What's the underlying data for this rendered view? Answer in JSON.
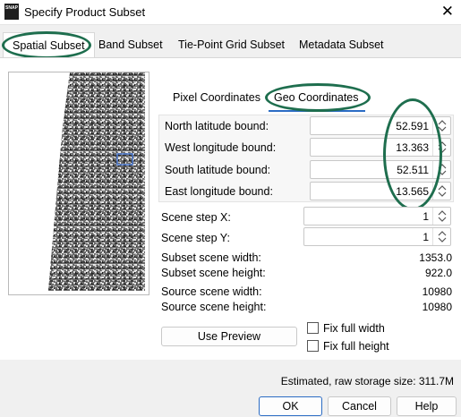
{
  "window": {
    "title": "Specify Product Subset",
    "app_icon_text": "SNAP"
  },
  "tabs": [
    {
      "label": "Spatial Subset",
      "active": true
    },
    {
      "label": "Band Subset"
    },
    {
      "label": "Tie-Point Grid Subset"
    },
    {
      "label": "Metadata Subset"
    }
  ],
  "sub_tabs": [
    {
      "label": "Pixel Coordinates"
    },
    {
      "label": "Geo Coordinates",
      "active": true
    }
  ],
  "geo": {
    "north_label": "North latitude bound:",
    "north_value": "52.591",
    "west_label": "West longitude bound:",
    "west_value": "13.363",
    "south_label": "South latitude bound:",
    "south_value": "52.511",
    "east_label": "East longitude bound:",
    "east_value": "13.565"
  },
  "step": {
    "x_label": "Scene step X:",
    "x_value": "1",
    "y_label": "Scene step Y:",
    "y_value": "1"
  },
  "info": {
    "subset_width_label": "Subset scene width:",
    "subset_width": "1353.0",
    "subset_height_label": "Subset scene height:",
    "subset_height": "922.0",
    "source_width_label": "Source scene width:",
    "source_width": "10980",
    "source_height_label": "Source scene height:",
    "source_height": "10980"
  },
  "options": {
    "use_preview": "Use Preview",
    "fix_width": "Fix full width",
    "fix_height": "Fix full height"
  },
  "storage": "Estimated, raw storage size: 311.7M",
  "buttons": {
    "ok": "OK",
    "cancel": "Cancel",
    "help": "Help"
  },
  "colors": {
    "annotation_ring": "#1e6e4e",
    "accent": "#2b6cc4",
    "selection_box": "#4a78d0"
  }
}
